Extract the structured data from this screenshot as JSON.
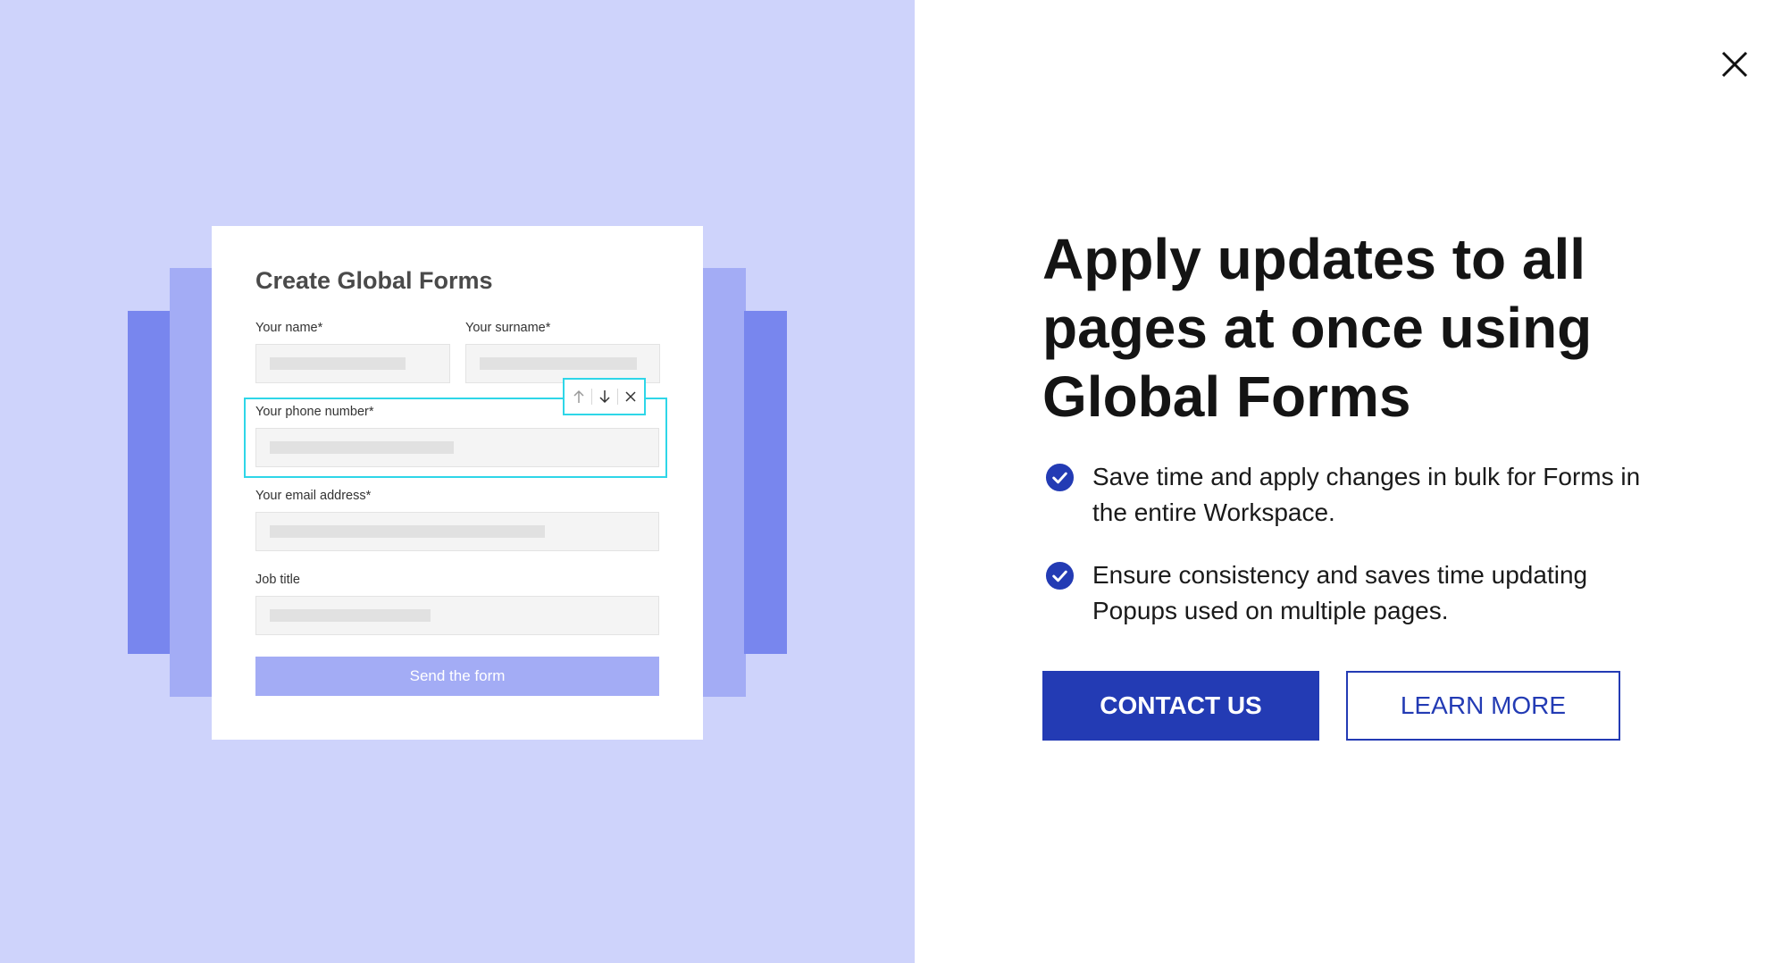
{
  "colors": {
    "panel_background": "#ced3fb",
    "layer_dark": "#7886ee",
    "layer_light": "#a3acf5",
    "highlight": "#2ed6e8",
    "brand_blue": "#233bb4",
    "headline": "#141414"
  },
  "illustration": {
    "form_title": "Create Global Forms",
    "fields": {
      "name_label": "Your name*",
      "surname_label": "Your surname*",
      "phone_label": "Your phone number*",
      "email_label": "Your email address*",
      "job_label": "Job title"
    },
    "toolbar_icons": [
      "arrow-up-icon",
      "arrow-down-icon",
      "close-icon"
    ],
    "send_button": "Send the form"
  },
  "content": {
    "headline": "Apply updates to all pages at once using Global Forms",
    "bullets": [
      {
        "icon": "check-circle-icon",
        "text": "Save time and apply changes in bulk for Forms in the entire Workspace."
      },
      {
        "icon": "check-circle-icon",
        "text": "Ensure consistency and saves time updating Popups used on multiple pages."
      }
    ],
    "primary_button": "CONTACT US",
    "secondary_button": "LEARN MORE"
  },
  "close_icon": "close-icon"
}
